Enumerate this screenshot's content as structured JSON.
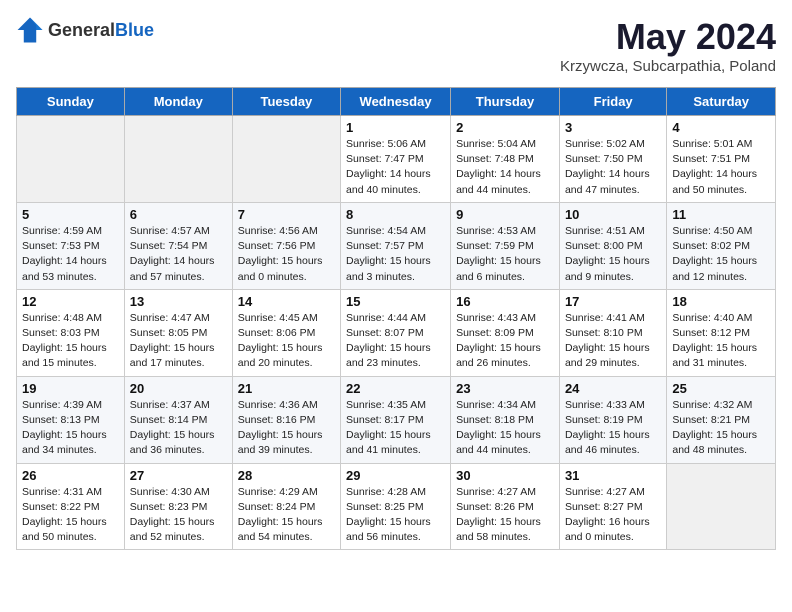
{
  "header": {
    "logo_general": "General",
    "logo_blue": "Blue",
    "month_title": "May 2024",
    "location": "Krzywcza, Subcarpathia, Poland"
  },
  "days_of_week": [
    "Sunday",
    "Monday",
    "Tuesday",
    "Wednesday",
    "Thursday",
    "Friday",
    "Saturday"
  ],
  "weeks": [
    [
      {
        "day": "",
        "sunrise": "",
        "sunset": "",
        "daylight": ""
      },
      {
        "day": "",
        "sunrise": "",
        "sunset": "",
        "daylight": ""
      },
      {
        "day": "",
        "sunrise": "",
        "sunset": "",
        "daylight": ""
      },
      {
        "day": "1",
        "sunrise": "Sunrise: 5:06 AM",
        "sunset": "Sunset: 7:47 PM",
        "daylight": "Daylight: 14 hours and 40 minutes."
      },
      {
        "day": "2",
        "sunrise": "Sunrise: 5:04 AM",
        "sunset": "Sunset: 7:48 PM",
        "daylight": "Daylight: 14 hours and 44 minutes."
      },
      {
        "day": "3",
        "sunrise": "Sunrise: 5:02 AM",
        "sunset": "Sunset: 7:50 PM",
        "daylight": "Daylight: 14 hours and 47 minutes."
      },
      {
        "day": "4",
        "sunrise": "Sunrise: 5:01 AM",
        "sunset": "Sunset: 7:51 PM",
        "daylight": "Daylight: 14 hours and 50 minutes."
      }
    ],
    [
      {
        "day": "5",
        "sunrise": "Sunrise: 4:59 AM",
        "sunset": "Sunset: 7:53 PM",
        "daylight": "Daylight: 14 hours and 53 minutes."
      },
      {
        "day": "6",
        "sunrise": "Sunrise: 4:57 AM",
        "sunset": "Sunset: 7:54 PM",
        "daylight": "Daylight: 14 hours and 57 minutes."
      },
      {
        "day": "7",
        "sunrise": "Sunrise: 4:56 AM",
        "sunset": "Sunset: 7:56 PM",
        "daylight": "Daylight: 15 hours and 0 minutes."
      },
      {
        "day": "8",
        "sunrise": "Sunrise: 4:54 AM",
        "sunset": "Sunset: 7:57 PM",
        "daylight": "Daylight: 15 hours and 3 minutes."
      },
      {
        "day": "9",
        "sunrise": "Sunrise: 4:53 AM",
        "sunset": "Sunset: 7:59 PM",
        "daylight": "Daylight: 15 hours and 6 minutes."
      },
      {
        "day": "10",
        "sunrise": "Sunrise: 4:51 AM",
        "sunset": "Sunset: 8:00 PM",
        "daylight": "Daylight: 15 hours and 9 minutes."
      },
      {
        "day": "11",
        "sunrise": "Sunrise: 4:50 AM",
        "sunset": "Sunset: 8:02 PM",
        "daylight": "Daylight: 15 hours and 12 minutes."
      }
    ],
    [
      {
        "day": "12",
        "sunrise": "Sunrise: 4:48 AM",
        "sunset": "Sunset: 8:03 PM",
        "daylight": "Daylight: 15 hours and 15 minutes."
      },
      {
        "day": "13",
        "sunrise": "Sunrise: 4:47 AM",
        "sunset": "Sunset: 8:05 PM",
        "daylight": "Daylight: 15 hours and 17 minutes."
      },
      {
        "day": "14",
        "sunrise": "Sunrise: 4:45 AM",
        "sunset": "Sunset: 8:06 PM",
        "daylight": "Daylight: 15 hours and 20 minutes."
      },
      {
        "day": "15",
        "sunrise": "Sunrise: 4:44 AM",
        "sunset": "Sunset: 8:07 PM",
        "daylight": "Daylight: 15 hours and 23 minutes."
      },
      {
        "day": "16",
        "sunrise": "Sunrise: 4:43 AM",
        "sunset": "Sunset: 8:09 PM",
        "daylight": "Daylight: 15 hours and 26 minutes."
      },
      {
        "day": "17",
        "sunrise": "Sunrise: 4:41 AM",
        "sunset": "Sunset: 8:10 PM",
        "daylight": "Daylight: 15 hours and 29 minutes."
      },
      {
        "day": "18",
        "sunrise": "Sunrise: 4:40 AM",
        "sunset": "Sunset: 8:12 PM",
        "daylight": "Daylight: 15 hours and 31 minutes."
      }
    ],
    [
      {
        "day": "19",
        "sunrise": "Sunrise: 4:39 AM",
        "sunset": "Sunset: 8:13 PM",
        "daylight": "Daylight: 15 hours and 34 minutes."
      },
      {
        "day": "20",
        "sunrise": "Sunrise: 4:37 AM",
        "sunset": "Sunset: 8:14 PM",
        "daylight": "Daylight: 15 hours and 36 minutes."
      },
      {
        "day": "21",
        "sunrise": "Sunrise: 4:36 AM",
        "sunset": "Sunset: 8:16 PM",
        "daylight": "Daylight: 15 hours and 39 minutes."
      },
      {
        "day": "22",
        "sunrise": "Sunrise: 4:35 AM",
        "sunset": "Sunset: 8:17 PM",
        "daylight": "Daylight: 15 hours and 41 minutes."
      },
      {
        "day": "23",
        "sunrise": "Sunrise: 4:34 AM",
        "sunset": "Sunset: 8:18 PM",
        "daylight": "Daylight: 15 hours and 44 minutes."
      },
      {
        "day": "24",
        "sunrise": "Sunrise: 4:33 AM",
        "sunset": "Sunset: 8:19 PM",
        "daylight": "Daylight: 15 hours and 46 minutes."
      },
      {
        "day": "25",
        "sunrise": "Sunrise: 4:32 AM",
        "sunset": "Sunset: 8:21 PM",
        "daylight": "Daylight: 15 hours and 48 minutes."
      }
    ],
    [
      {
        "day": "26",
        "sunrise": "Sunrise: 4:31 AM",
        "sunset": "Sunset: 8:22 PM",
        "daylight": "Daylight: 15 hours and 50 minutes."
      },
      {
        "day": "27",
        "sunrise": "Sunrise: 4:30 AM",
        "sunset": "Sunset: 8:23 PM",
        "daylight": "Daylight: 15 hours and 52 minutes."
      },
      {
        "day": "28",
        "sunrise": "Sunrise: 4:29 AM",
        "sunset": "Sunset: 8:24 PM",
        "daylight": "Daylight: 15 hours and 54 minutes."
      },
      {
        "day": "29",
        "sunrise": "Sunrise: 4:28 AM",
        "sunset": "Sunset: 8:25 PM",
        "daylight": "Daylight: 15 hours and 56 minutes."
      },
      {
        "day": "30",
        "sunrise": "Sunrise: 4:27 AM",
        "sunset": "Sunset: 8:26 PM",
        "daylight": "Daylight: 15 hours and 58 minutes."
      },
      {
        "day": "31",
        "sunrise": "Sunrise: 4:27 AM",
        "sunset": "Sunset: 8:27 PM",
        "daylight": "Daylight: 16 hours and 0 minutes."
      },
      {
        "day": "",
        "sunrise": "",
        "sunset": "",
        "daylight": ""
      }
    ]
  ]
}
